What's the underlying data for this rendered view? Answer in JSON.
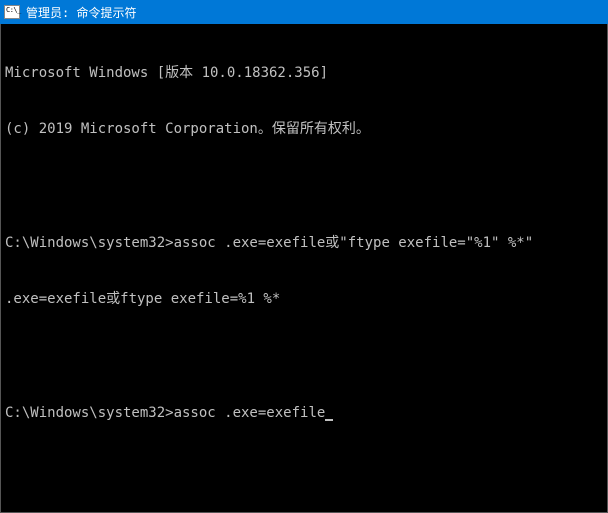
{
  "window": {
    "title": "管理员: 命令提示符"
  },
  "terminal": {
    "line1": "Microsoft Windows [版本 10.0.18362.356]",
    "line2": "(c) 2019 Microsoft Corporation。保留所有权利。",
    "blank1": "",
    "prompt1": "C:\\Windows\\system32>",
    "command1": "assoc .exe=exefile或\"ftype exefile=\"%1\" %*\"",
    "output1": ".exe=exefile或ftype exefile=%1 %*",
    "blank2": "",
    "prompt2": "C:\\Windows\\system32>",
    "command2": "assoc .exe=exefile"
  }
}
